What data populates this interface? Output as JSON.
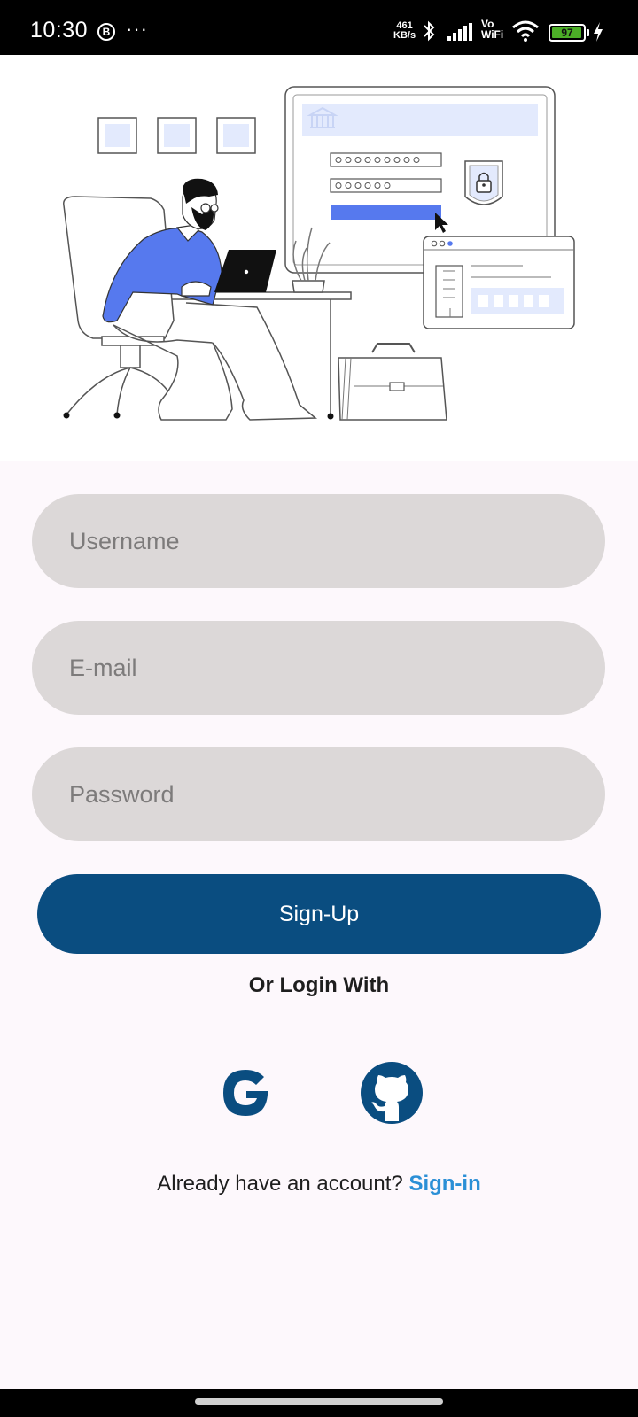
{
  "status_bar": {
    "time": "10:30",
    "b_badge": "B",
    "dots": "···",
    "speed_value": "461",
    "speed_unit": "KB/s",
    "vo": "Vo",
    "wifi_label": "WiFi",
    "battery": "97",
    "battery_level": 0.97
  },
  "form": {
    "username_placeholder": "Username",
    "email_placeholder": "E-mail",
    "password_placeholder": "Password",
    "signup_label": "Sign-Up"
  },
  "social": {
    "heading": "Or Login With",
    "providers": [
      "google-icon",
      "github-icon"
    ]
  },
  "footer": {
    "prompt": "Already have an account? ",
    "link": "Sign-in"
  },
  "colors": {
    "primary": "#0a4d80",
    "link": "#2b8fd6",
    "field_bg": "#dcd8d8",
    "illustration_accent": "#5679ee"
  }
}
